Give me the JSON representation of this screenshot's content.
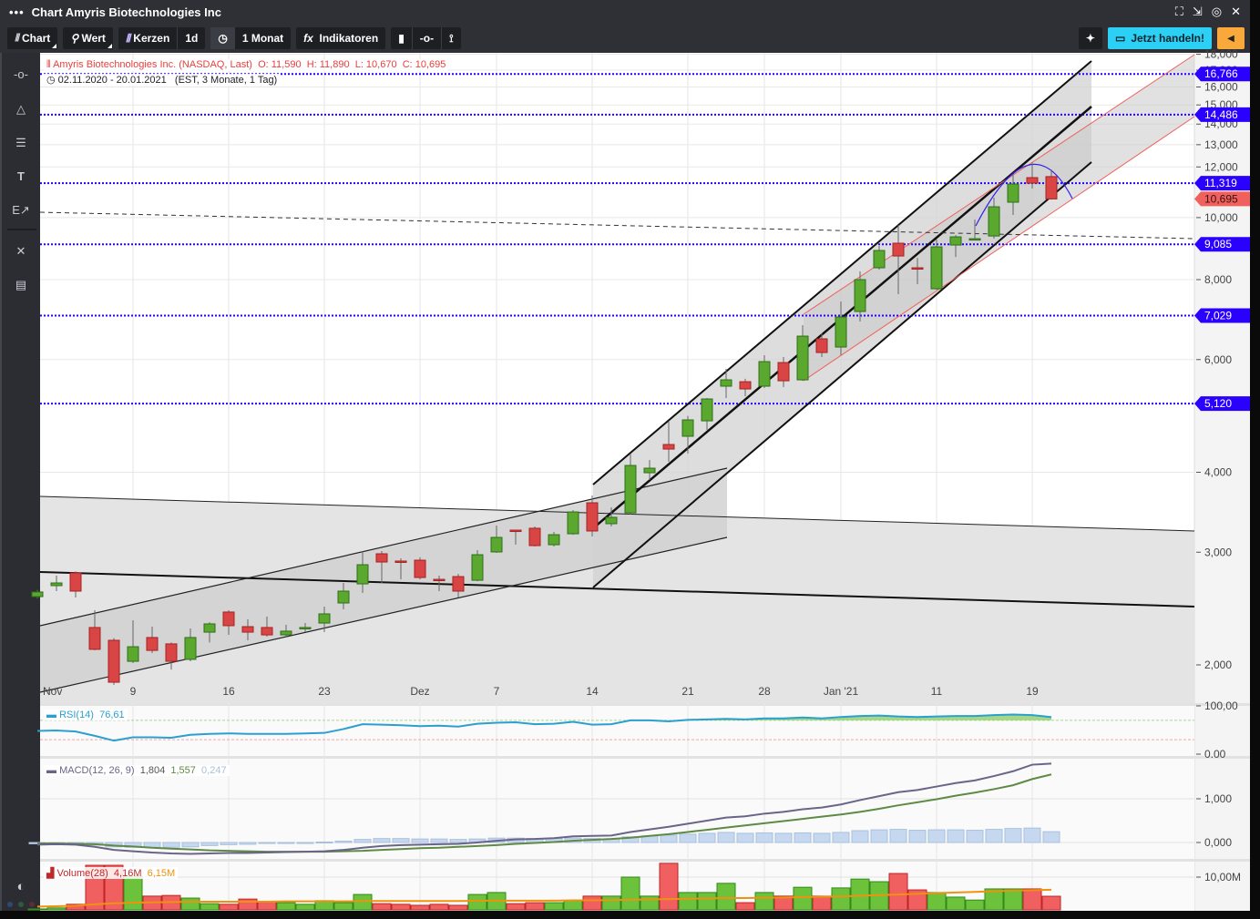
{
  "window": {
    "menu_icon": "more-dots-icon",
    "title": "Chart Amyris Biotechnologies Inc",
    "controls": [
      "fullscreen-icon",
      "popout-icon",
      "target-icon",
      "close-icon"
    ]
  },
  "toolbar": {
    "chart_label": "Chart",
    "wert_label": "Wert",
    "kerzen_label": "Kerzen",
    "interval_label": "1d",
    "period_label": "1 Monat",
    "indicators_label": "Indikatoren",
    "fx_symbol": "fx",
    "trade_label": "Jetzt handeln!",
    "colors": {
      "trade": "#2cd0f4",
      "orange": "#f9a93b"
    }
  },
  "sidebar": {
    "icons": [
      "line-icon",
      "triangle-icon",
      "fibonacci-icon",
      "text-icon",
      "edit-arrow-icon",
      "tools-icon",
      "list-icon",
      "contrast-icon"
    ]
  },
  "legend": {
    "instrument": "Amyris Biotechnologies Inc. (NASDAQ, Last)",
    "open": "O: 11,590",
    "high": "H: 11,890",
    "low": "L: 10,670",
    "close": "C: 10,695",
    "range": "02.11.2020 - 20.01.2021",
    "range_info": "(EST, 3 Monate, 1 Tag)",
    "rsi_label": "RSI(14)",
    "rsi_value": "76,61",
    "macd_label": "MACD(12, 26, 9)",
    "macd_value": "1,804",
    "macd_signal": "1,557",
    "macd_hist": "0,247",
    "volume_label": "Volume(28)",
    "volume_value": "4,16M",
    "volume_ma": "6,15M"
  },
  "chart_data": [
    {
      "type": "candlestick",
      "scale": "log",
      "ylim": [
        1850,
        18000
      ],
      "y_ticks": [
        "2,000",
        "3,000",
        "4,000",
        "6,000",
        "8,000",
        "10,000",
        "12,000",
        "13,000",
        "14,000",
        "15,000",
        "16,000",
        "17,000",
        "18,000"
      ],
      "y_tick_values": [
        2000,
        3000,
        4000,
        6000,
        8000,
        10000,
        12000,
        13000,
        14000,
        15000,
        16000,
        17000,
        18000
      ],
      "x_labels": [
        {
          "i": 0,
          "label": "Nov"
        },
        {
          "i": 5,
          "label": "9"
        },
        {
          "i": 10,
          "label": "16"
        },
        {
          "i": 15,
          "label": "23"
        },
        {
          "i": 20,
          "label": "Dez"
        },
        {
          "i": 24,
          "label": "7"
        },
        {
          "i": 29,
          "label": "14"
        },
        {
          "i": 34,
          "label": "21"
        },
        {
          "i": 38,
          "label": "28"
        },
        {
          "i": 42,
          "label": "Jan '21"
        },
        {
          "i": 47,
          "label": "11"
        },
        {
          "i": 52,
          "label": "19"
        }
      ],
      "grid": true,
      "colors": {
        "up": "#5aa82d",
        "down": "#d94444",
        "level": "#2a00ff",
        "last": "#f0605c"
      },
      "price_levels": [
        {
          "value": 16766,
          "label": "16,766"
        },
        {
          "value": 14486,
          "label": "14,486"
        },
        {
          "value": 11319,
          "label": "11,319"
        },
        {
          "value": 9085,
          "label": "9,085"
        },
        {
          "value": 7029,
          "label": "7,029"
        },
        {
          "value": 5120,
          "label": "5,120"
        }
      ],
      "last_price": {
        "value": 10695,
        "label": "10,695"
      },
      "candles": [
        [
          "02.11.2020",
          2557,
          2620,
          2540,
          2600
        ],
        [
          "03.11.2020",
          2660,
          2757,
          2608,
          2686
        ],
        [
          "04.11.2020",
          2784,
          2800,
          2549,
          2608
        ],
        [
          "05.11.2020",
          2288,
          2435,
          2108,
          2115
        ],
        [
          "06.11.2020",
          2185,
          2202,
          1861,
          1879
        ],
        [
          "09.11.2020",
          2026,
          2348,
          2013,
          2135
        ],
        [
          "10.11.2020",
          2207,
          2295,
          2087,
          2107
        ],
        [
          "11.11.2020",
          2157,
          2168,
          1967,
          2026
        ],
        [
          "12.11.2020",
          2040,
          2280,
          2026,
          2207
        ],
        [
          "13.11.2020",
          2250,
          2332,
          2168,
          2318
        ],
        [
          "16.11.2020",
          2419,
          2435,
          2228,
          2303
        ],
        [
          "17.11.2020",
          2295,
          2356,
          2185,
          2250
        ],
        [
          "18.11.2020",
          2288,
          2379,
          2214,
          2228
        ],
        [
          "19.11.2020",
          2228,
          2310,
          2207,
          2258
        ],
        [
          "20.11.2020",
          2280,
          2325,
          2250,
          2288
        ],
        [
          "23.11.2020",
          2325,
          2467,
          2250,
          2403
        ],
        [
          "24.11.2020",
          2499,
          2686,
          2443,
          2608
        ],
        [
          "25.11.2020",
          2677,
          3012,
          2591,
          2868
        ],
        [
          "27.11.2020",
          2983,
          3012,
          2686,
          2896
        ],
        [
          "30.11.2020",
          2906,
          2935,
          2721,
          2896
        ],
        [
          "01.12.2020",
          2915,
          2945,
          2721,
          2739
        ],
        [
          "02.12.2020",
          2721,
          2757,
          2608,
          2717
        ],
        [
          "03.12.2020",
          2748,
          2775,
          2549,
          2608
        ],
        [
          "04.12.2020",
          2712,
          3022,
          2703,
          2973
        ],
        [
          "07.12.2020",
          3003,
          3302,
          2993,
          3164
        ],
        [
          "08.12.2020",
          3248,
          3248,
          3082,
          3238
        ],
        [
          "09.12.2020",
          3270,
          3292,
          3063,
          3072
        ],
        [
          "10.12.2020",
          3082,
          3227,
          3063,
          3195
        ],
        [
          "11.12.2020",
          3206,
          3492,
          3195,
          3468
        ],
        [
          "14.12.2020",
          3584,
          3679,
          3175,
          3238
        ],
        [
          "15.12.2020",
          3324,
          3526,
          3292,
          3401
        ],
        [
          "16.12.2020",
          3457,
          4278,
          3435,
          4099
        ],
        [
          "17.12.2020",
          3993,
          4181,
          3890,
          4059
        ],
        [
          "18.12.2020",
          4420,
          4798,
          4154,
          4348
        ],
        [
          "21.12.2020",
          4553,
          4900,
          4278,
          4829
        ],
        [
          "22.12.2020",
          4813,
          5225,
          4658,
          5207
        ],
        [
          "23.12.2020",
          5452,
          5802,
          5225,
          5578
        ],
        [
          "24.12.2020",
          5541,
          5600,
          5259,
          5398
        ],
        [
          "28.12.2020",
          5452,
          6094,
          5416,
          5956
        ],
        [
          "29.12.2020",
          5936,
          6054,
          5434,
          5559
        ],
        [
          "30.12.2020",
          5578,
          6790,
          5559,
          6528
        ],
        [
          "31.12.2020",
          6465,
          6590,
          6054,
          6154
        ],
        [
          "04.01.2021",
          6277,
          7394,
          6094,
          6993
        ],
        [
          "05.01.2021",
          7133,
          8239,
          6880,
          8000
        ],
        [
          "06.01.2021",
          8348,
          9030,
          8290,
          8884
        ],
        [
          "07.01.2021",
          9120,
          9738,
          7590,
          8710
        ],
        [
          "08.01.2021",
          8348,
          8650,
          7869,
          8320
        ],
        [
          "11.01.2021",
          7741,
          9240,
          7715,
          9001
        ],
        [
          "12.01.2021",
          9060,
          9390,
          8680,
          9331
        ],
        [
          "13.01.2021",
          9240,
          9931,
          9210,
          9270
        ],
        [
          "14.01.2021",
          9360,
          10744,
          9270,
          10397
        ],
        [
          "15.01.2021",
          10569,
          11699,
          10095,
          11285
        ],
        [
          "19.01.2021",
          11547,
          12208,
          11101,
          11322
        ],
        [
          "20.01.2021",
          11590,
          11890,
          10670,
          10695
        ]
      ]
    },
    {
      "type": "line",
      "name": "RSI(14)",
      "ylim": [
        0,
        100
      ],
      "y_ticks": [
        "100,00",
        "0.00"
      ],
      "levels": [
        70,
        30
      ],
      "color": "#2a9fd0",
      "values": [
        48,
        49,
        47,
        38,
        28,
        35,
        35,
        34,
        40,
        42,
        43,
        42,
        42,
        42,
        43,
        44,
        52,
        62,
        61,
        60,
        58,
        59,
        57,
        63,
        65,
        66,
        62,
        63,
        67,
        61,
        62,
        70,
        70,
        68,
        71,
        72,
        73,
        72,
        74,
        74,
        76,
        74,
        77,
        79,
        80,
        78,
        77,
        78,
        79,
        79,
        81,
        82,
        81,
        76.61
      ]
    },
    {
      "type": "line",
      "name": "MACD(12, 26, 9)",
      "y_ticks": [
        "1,000",
        "0,000"
      ],
      "colors": {
        "macd": "#6a6488",
        "signal": "#5e8a45",
        "hist": "#c5d8ef"
      },
      "macd": [
        -0.05,
        -0.04,
        -0.05,
        -0.1,
        -0.17,
        -0.2,
        -0.23,
        -0.25,
        -0.26,
        -0.25,
        -0.24,
        -0.24,
        -0.23,
        -0.22,
        -0.21,
        -0.2,
        -0.17,
        -0.12,
        -0.08,
        -0.06,
        -0.05,
        -0.04,
        -0.03,
        0,
        0.04,
        0.07,
        0.08,
        0.1,
        0.14,
        0.15,
        0.16,
        0.24,
        0.3,
        0.36,
        0.43,
        0.5,
        0.57,
        0.6,
        0.66,
        0.7,
        0.76,
        0.8,
        0.87,
        0.97,
        1.06,
        1.15,
        1.2,
        1.28,
        1.36,
        1.42,
        1.52,
        1.63,
        1.78,
        1.804
      ],
      "signal": [
        -0.02,
        -0.02,
        -0.03,
        -0.04,
        -0.07,
        -0.09,
        -0.12,
        -0.14,
        -0.16,
        -0.18,
        -0.19,
        -0.2,
        -0.21,
        -0.21,
        -0.21,
        -0.21,
        -0.2,
        -0.19,
        -0.17,
        -0.15,
        -0.13,
        -0.12,
        -0.1,
        -0.08,
        -0.06,
        -0.03,
        -0.01,
        0.01,
        0.04,
        0.06,
        0.08,
        0.11,
        0.15,
        0.19,
        0.24,
        0.29,
        0.34,
        0.39,
        0.44,
        0.49,
        0.54,
        0.59,
        0.64,
        0.7,
        0.77,
        0.85,
        0.92,
        0.99,
        1.07,
        1.14,
        1.22,
        1.31,
        1.45,
        1.557
      ]
    },
    {
      "type": "bar",
      "name": "Volume(28)",
      "unit": "M",
      "y_ticks": [
        "10,00M"
      ],
      "colors": {
        "ma": "#f0920f"
      },
      "values": [
        0.3,
        0.6,
        1.7,
        13.6,
        13.6,
        10.3,
        4.2,
        4.4,
        3.6,
        1.9,
        1.7,
        3.3,
        2.5,
        2.2,
        1.7,
        2.8,
        2.2,
        4.7,
        1.9,
        1.7,
        1.4,
        1.7,
        1.4,
        4.7,
        5.3,
        1.9,
        2.2,
        2.2,
        2.8,
        4.2,
        4.2,
        10.0,
        4.2,
        14.2,
        5.3,
        5.3,
        8.1,
        2.2,
        5.3,
        4.2,
        6.9,
        4.2,
        6.7,
        9.4,
        8.6,
        11.1,
        6.1,
        5.3,
        3.9,
        3.0,
        6.4,
        6.4,
        6.4,
        4.16
      ],
      "ma": [
        1.0,
        1.1,
        1.3,
        1.7,
        2.0,
        2.2,
        2.3,
        2.4,
        2.5,
        2.5,
        2.5,
        2.5,
        2.5,
        2.6,
        2.6,
        2.6,
        2.6,
        2.7,
        2.7,
        2.7,
        2.7,
        2.7,
        2.7,
        2.8,
        2.8,
        2.8,
        2.8,
        2.8,
        2.9,
        2.9,
        3.0,
        3.1,
        3.2,
        3.3,
        3.4,
        3.5,
        3.6,
        3.6,
        3.7,
        3.8,
        3.9,
        4.0,
        4.1,
        4.3,
        4.5,
        4.7,
        4.9,
        5.1,
        5.3,
        5.5,
        5.7,
        5.9,
        6.0,
        6.15
      ]
    }
  ]
}
